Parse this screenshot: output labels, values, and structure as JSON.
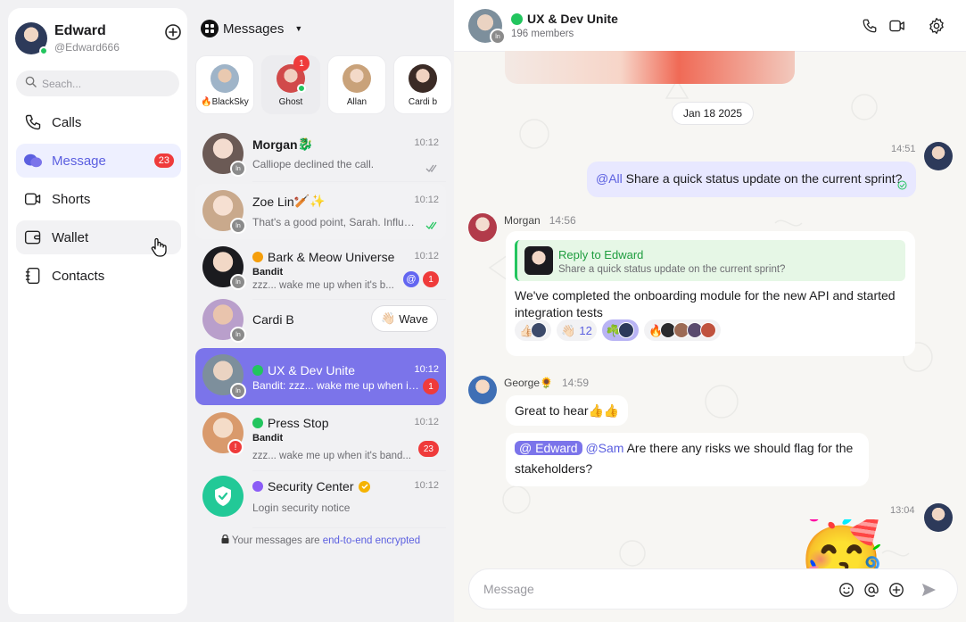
{
  "user": {
    "name": "Edward",
    "handle": "@Edward666"
  },
  "search": {
    "placeholder": "Seach..."
  },
  "nav": {
    "items": [
      {
        "label": "Calls",
        "icon": "phone-icon"
      },
      {
        "label": "Message",
        "icon": "chat-bubbles-icon",
        "badge": "23"
      },
      {
        "label": "Shorts",
        "icon": "video-icon"
      },
      {
        "label": "Wallet",
        "icon": "wallet-icon"
      },
      {
        "label": "Contacts",
        "icon": "contacts-icon"
      }
    ]
  },
  "list": {
    "header": "Messages",
    "stories": [
      {
        "label": "🔥BlackSky"
      },
      {
        "label": "Ghost",
        "badge": "1"
      },
      {
        "label": "Allan"
      },
      {
        "label": "Cardi b"
      }
    ],
    "conversations": [
      {
        "name": "Morgan",
        "emoji": "🐉",
        "time": "10:12",
        "preview": "Calliope declined the call."
      },
      {
        "name": "Zoe Lin",
        "emoji": "🏏✨",
        "time": "10:12",
        "preview": "That's a good point, Sarah. Influe..."
      },
      {
        "name": "Bark & Meow Universe",
        "time": "10:12",
        "sender": "Bandit",
        "preview": "zzz... wake me up when it's b...",
        "badge": "1",
        "mention": "@"
      },
      {
        "name": "Cardi B",
        "wave_label": "Wave",
        "wave_emoji": "👋🏻"
      },
      {
        "name": "UX & Dev Unite",
        "time": "10:12",
        "preview": "Bandit: zzz... wake me up when it'...",
        "badge": "1"
      },
      {
        "name": "Press Stop",
        "time": "10:12",
        "sender": "Bandit",
        "preview": "zzz... wake me up when it's band...",
        "badge": "23"
      },
      {
        "name": "Security Center",
        "time": "10:12",
        "preview": "Login security notice"
      }
    ],
    "footer": {
      "text": "Your messages are ",
      "link": "end-to-end encrypted"
    }
  },
  "chat": {
    "title": "UX & Dev Unite",
    "members": "196 members",
    "date": "Jan 18 2025",
    "messages": {
      "m1": {
        "time": "14:51",
        "mention": "@All",
        "text": " Share a quick status update on the current sprint?"
      },
      "m2": {
        "sender": "Morgan",
        "time": "14:56",
        "reply_title": "Reply to Edward",
        "reply_text": "Share a quick status update on the current sprint?",
        "text_line1": "We've completed the onboarding module for the new API and started",
        "text_line2": "integration tests",
        "reactions": [
          {
            "emoji": "👍🏻"
          },
          {
            "emoji": "👋🏻",
            "count": "12"
          },
          {
            "emoji": "☘️"
          },
          {
            "emoji": "🔥"
          }
        ]
      },
      "m3": {
        "sender": "George🌻",
        "time": "14:59",
        "text": "Great to hear👍👍"
      },
      "m4": {
        "mention1": "@ Edward",
        "mention2": "@Sam",
        "text_line1": " Are there any risks we should flag for the",
        "text_line2": "stakeholders?"
      },
      "m5": {
        "time": "13:04",
        "sticker": "🥳"
      }
    },
    "composer": {
      "placeholder": "Message"
    }
  },
  "colors": {
    "accent": "#7b74ea",
    "badge": "#ef3b3b",
    "online": "#22c55e",
    "reply": "#1f9d3f"
  }
}
